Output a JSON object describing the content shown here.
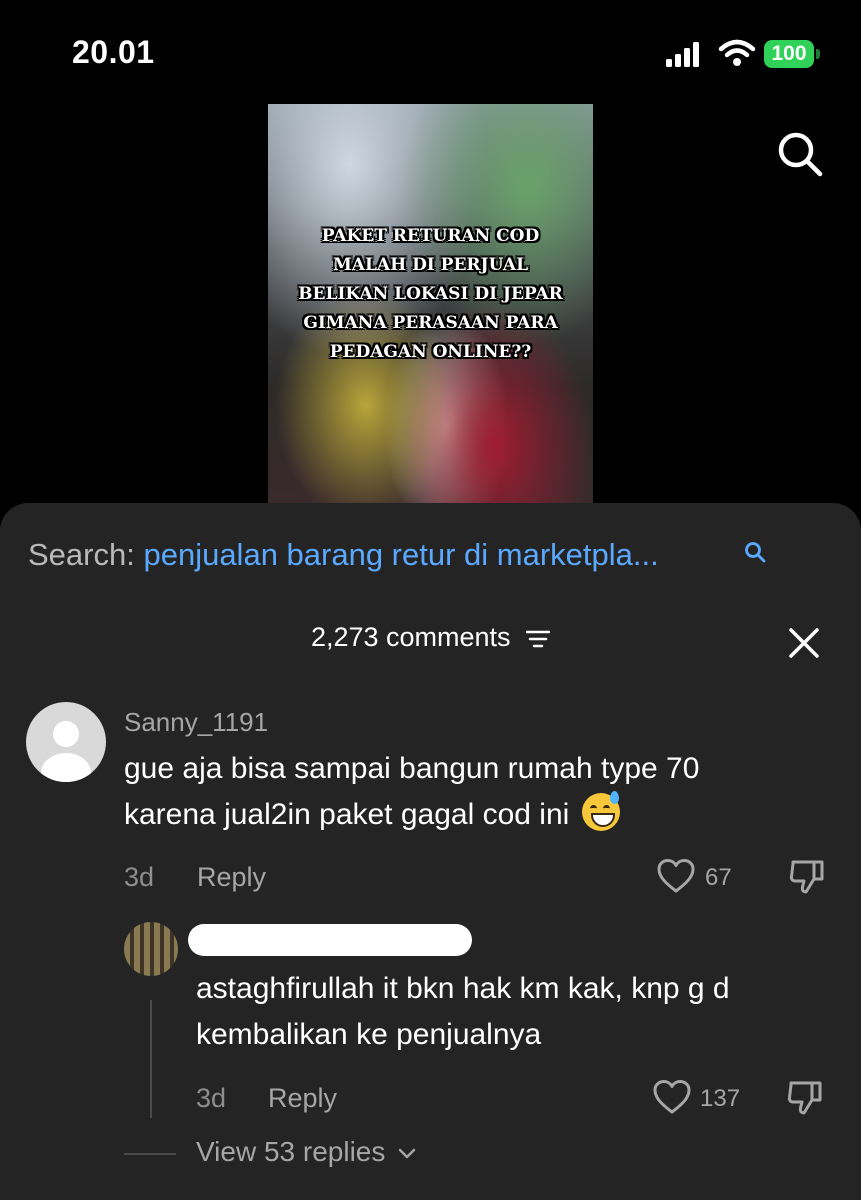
{
  "status_bar": {
    "time": "20.01",
    "battery": "100"
  },
  "video": {
    "overlay_lines": [
      "PAKET RETURAN COD",
      "MALAH DI PERJUAL",
      "BELIKAN LOKASI DI JEPAR",
      "GIMANA PERASAAN PARA",
      "PEDAGAN ONLINE??"
    ]
  },
  "search": {
    "label": "Search:",
    "query": "penjualan barang retur di marketpla..."
  },
  "comments_header": {
    "count_label": "2,273 comments"
  },
  "comments": [
    {
      "username": "Sanny_1191",
      "text_line1": "gue aja bisa sampai bangun rumah type 70",
      "text_line2": "karena jual2in paket gagal cod ini",
      "age": "3d",
      "reply_label": "Reply",
      "likes": "67"
    }
  ],
  "reply": {
    "text_line1": "astaghfirullah it bkn hak km kak, knp g d",
    "text_line2": "kembalikan ke penjualnya",
    "age": "3d",
    "reply_label": "Reply",
    "likes": "137"
  },
  "view_replies_label": "View 53 replies",
  "colors": {
    "sheet_bg": "#242424",
    "link_blue": "#5aa9ff",
    "battery_green": "#30d158"
  }
}
